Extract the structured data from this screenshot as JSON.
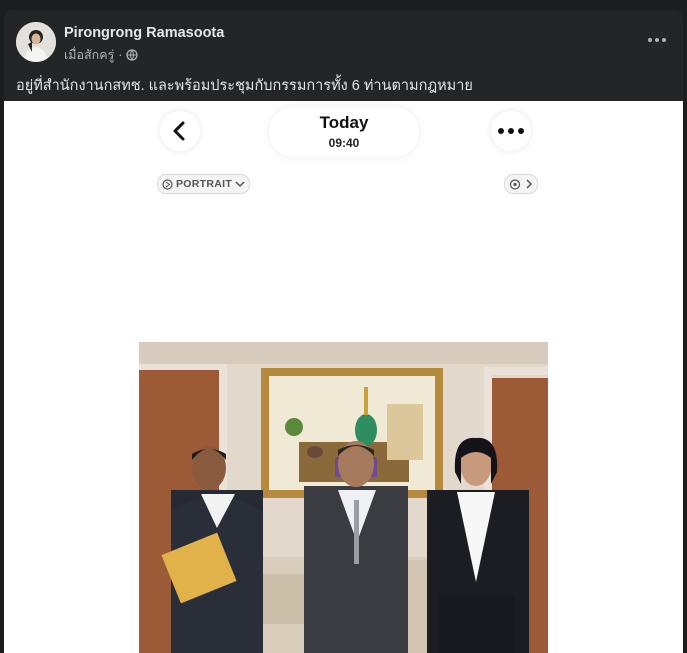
{
  "post": {
    "author": "Pirongrong Ramasoota",
    "timestamp": "เมื่อสักครู่",
    "separator": "·",
    "caption": "อยู่ที่สำนักงานกสทช. และพร้อมประชุมกับกรรมการทั้ง 6 ท่านตามกฎหมาย",
    "privacy_icon": "globe-icon",
    "more_icon": "more-options-icon"
  },
  "phone_ui": {
    "date_title": "Today",
    "time": "09:40",
    "portrait_label": "PORTRAIT",
    "back_icon": "chevron-left-icon",
    "more_icon": "ellipsis-icon"
  },
  "colors": {
    "page_bg": "#1c1d1f",
    "card_bg": "#242526",
    "primary_text": "#e4e6eb",
    "secondary_text": "#b0b3b8"
  }
}
